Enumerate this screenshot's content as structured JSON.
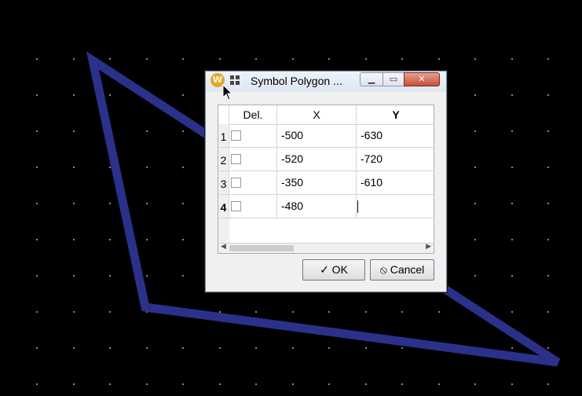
{
  "dialog": {
    "title": "Symbol Polygon ...",
    "app_icon_letter": "W",
    "minimize_glyph": "▁",
    "maximize_glyph": "▭",
    "close_glyph": "✕"
  },
  "table": {
    "columns": [
      "Del.",
      "X",
      "Y"
    ],
    "rows": [
      {
        "num": "1",
        "x": "-500",
        "y": "-630"
      },
      {
        "num": "2",
        "x": "-520",
        "y": "-720"
      },
      {
        "num": "3",
        "x": "-350",
        "y": "-610"
      },
      {
        "num": "4",
        "x": "-480",
        "y": ""
      }
    ]
  },
  "buttons": {
    "ok": "✓ OK",
    "cancel": "⦸ Cancel"
  },
  "colors": {
    "polygon_stroke": "#2b3188",
    "grid_dot": "#8a8a8a",
    "canvas_bg": "#000000"
  }
}
